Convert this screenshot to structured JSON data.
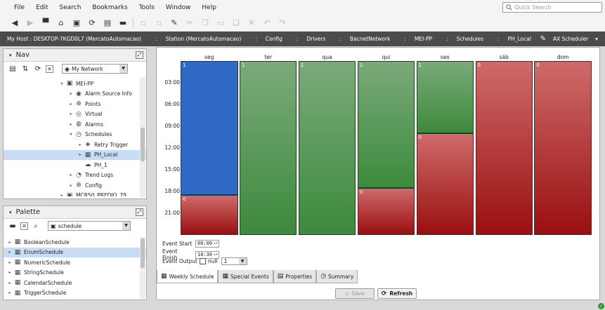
{
  "menu": [
    "File",
    "Edit",
    "Search",
    "Bookmarks",
    "Tools",
    "Window",
    "Help"
  ],
  "search": {
    "placeholder": "Quick Search"
  },
  "location": {
    "crumbs": [
      "My Host : DESKTOP-7KGD0L7 (MercatoAutomacao)",
      "Station (MercatoAutomacao)",
      "Config",
      "Drivers",
      "BacnetNetwork",
      "MEI-PP",
      "Schedules",
      "PH_Local"
    ],
    "view": "AX Scheduler"
  },
  "nav": {
    "title": "Nav",
    "combo": "My Network",
    "items": [
      {
        "label": "MEI-PP",
        "icon": "device-icon",
        "indent": 0,
        "twisty": "▾"
      },
      {
        "label": "Alarm Source Info",
        "icon": "alarm-info-icon",
        "indent": 1,
        "twisty": "▸"
      },
      {
        "label": "Points",
        "icon": "points-icon",
        "indent": 1,
        "twisty": "▸"
      },
      {
        "label": "Virtual",
        "icon": "virtual-icon",
        "indent": 1,
        "twisty": "▸"
      },
      {
        "label": "Alarms",
        "icon": "alarms-icon",
        "indent": 1,
        "twisty": "▸"
      },
      {
        "label": "Schedules",
        "icon": "schedules-icon",
        "indent": 1,
        "twisty": "▾"
      },
      {
        "label": "Retry Trigger",
        "icon": "trigger-icon",
        "indent": 2,
        "twisty": "▸"
      },
      {
        "label": "PH_Local",
        "icon": "schedule-grid-icon",
        "indent": 2,
        "twisty": "▸",
        "selected": true
      },
      {
        "label": "PH_1",
        "icon": "schedule-link-icon",
        "indent": 2,
        "twisty": ""
      },
      {
        "label": "Trend Logs",
        "icon": "trend-icon",
        "indent": 1,
        "twisty": "▸"
      },
      {
        "label": "Config",
        "icon": "config-icon",
        "indent": 1,
        "twisty": "▸"
      },
      {
        "label": "MCR50_PREDIO_79",
        "icon": "device-icon",
        "indent": 0,
        "twisty": "▸"
      }
    ]
  },
  "palette": {
    "title": "Palette",
    "combo": "schedule",
    "items": [
      "BooleanSchedule",
      "EnumSchedule",
      "NumericSchedule",
      "StringSchedule",
      "CalendarSchedule",
      "TriggerSchedule"
    ],
    "selected": 1
  },
  "schedule": {
    "days": [
      "seg",
      "ter",
      "qua",
      "qui",
      "sex",
      "sáb",
      "dom"
    ],
    "hours": [
      "03:00",
      "06:00",
      "09:00",
      "12:00",
      "15:00",
      "18:00",
      "21:00"
    ],
    "blocks": [
      [
        {
          "start": 0,
          "end": 18.5,
          "value": "1",
          "color": "blue"
        },
        {
          "start": 18.5,
          "end": 24,
          "value": "0",
          "color": "red"
        }
      ],
      [
        {
          "start": 0,
          "end": 24,
          "value": "1",
          "color": "green"
        }
      ],
      [
        {
          "start": 0,
          "end": 24,
          "value": "1",
          "color": "green"
        }
      ],
      [
        {
          "start": 0,
          "end": 17.5,
          "value": "1",
          "color": "green"
        },
        {
          "start": 17.5,
          "end": 24,
          "value": "0",
          "color": "red"
        }
      ],
      [
        {
          "start": 0,
          "end": 10,
          "value": "1",
          "color": "green"
        },
        {
          "start": 10,
          "end": 24,
          "value": "0",
          "color": "red"
        }
      ],
      [
        {
          "start": 0,
          "end": 24,
          "value": "0",
          "color": "red"
        }
      ],
      [
        {
          "start": 0,
          "end": 24,
          "value": "0",
          "color": "red"
        }
      ]
    ],
    "event_start_label": "Event Start",
    "event_start": "00:00",
    "event_finish_label": "Event Finish",
    "event_finish": "18:30",
    "event_output_label": "Event Output",
    "null_label": "null",
    "output_value": "1"
  },
  "tabs": [
    "Weekly Schedule",
    "Special Events",
    "Properties",
    "Summary"
  ],
  "buttons": {
    "save": "Save",
    "refresh": "Refresh"
  }
}
